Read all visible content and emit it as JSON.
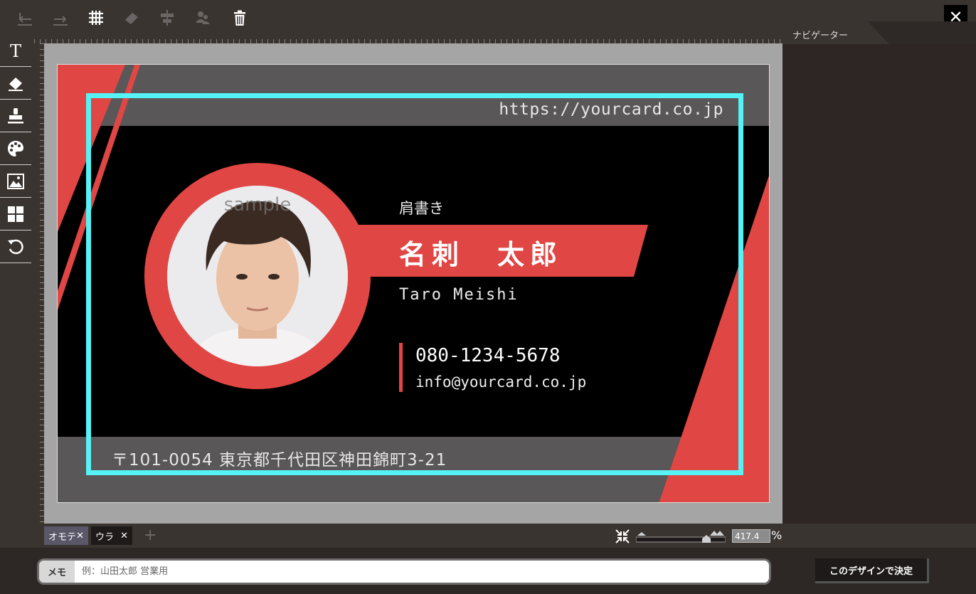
{
  "toolbar": {
    "icons": [
      "undo-icon",
      "redo-icon",
      "grid-icon",
      "eraser-icon",
      "align-icon",
      "group-icon",
      "trash-icon"
    ],
    "close_label": "✕"
  },
  "left_tools": [
    "text-tool-icon",
    "shape-tool-icon",
    "stamp-tool-icon",
    "palette-tool-icon",
    "image-tool-icon",
    "layout-tool-icon",
    "reset-tool-icon"
  ],
  "navigator": {
    "label": "ナビゲーター"
  },
  "card": {
    "url": "https://yourcard.co.jp",
    "title": "肩書き",
    "name_jp": "名刺　太郎",
    "name_en": "Taro Meishi",
    "phone": "080-1234-5678",
    "email": "info@yourcard.co.jp",
    "address": "〒101-0054 東京都千代田区神田錦町3-21",
    "photo_watermark": "sample",
    "colors": {
      "accent": "#e04644",
      "guide": "#55f2f6",
      "band": "#595757"
    }
  },
  "pages": {
    "front_label": "オモテ",
    "back_label": "ウラ",
    "close": "✕",
    "add": "+"
  },
  "zoom": {
    "value": "417.4",
    "unit": "%"
  },
  "memo": {
    "label": "メモ",
    "placeholder": "例：山田太郎 営業用",
    "value": ""
  },
  "decide_button": "このデザインで決定"
}
